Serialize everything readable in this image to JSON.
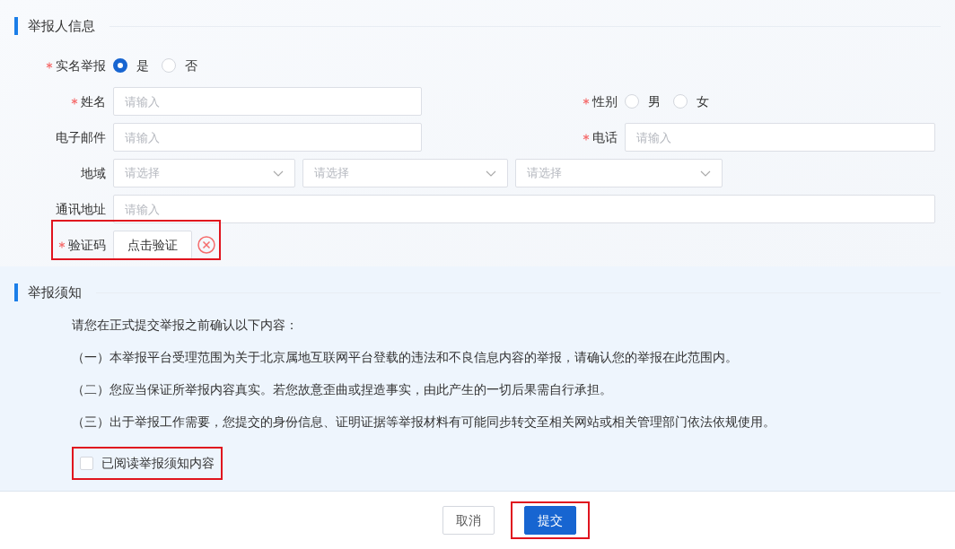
{
  "reporter_info": {
    "title": "举报人信息",
    "rows": [
      [
        {
          "kind": "radio",
          "label": "实名举报",
          "required": true,
          "options": [
            {
              "label": "是",
              "selected": true
            },
            {
              "label": "否",
              "selected": false
            }
          ]
        }
      ],
      [
        {
          "kind": "input",
          "label": "姓名",
          "required": true,
          "placeholder": "请输入"
        },
        {
          "kind": "radio",
          "label": "性别",
          "required": true,
          "options": [
            {
              "label": "男",
              "selected": false
            },
            {
              "label": "女",
              "selected": false
            }
          ]
        }
      ],
      [
        {
          "kind": "input",
          "label": "电子邮件",
          "required": false,
          "placeholder": "请输入"
        },
        {
          "kind": "input",
          "label": "电话",
          "required": true,
          "placeholder": "请输入"
        }
      ],
      [
        {
          "kind": "selects",
          "label": "地域",
          "required": false,
          "selects": [
            {
              "placeholder": "请选择"
            },
            {
              "placeholder": "请选择"
            },
            {
              "placeholder": "请选择"
            }
          ]
        }
      ],
      [
        {
          "kind": "input",
          "label": "通讯地址",
          "required": false,
          "placeholder": "请输入"
        }
      ],
      [
        {
          "kind": "captcha",
          "label": "验证码",
          "required": true,
          "button": "点击验证",
          "error": true,
          "highlighted": true
        }
      ]
    ]
  },
  "notice": {
    "title": "举报须知",
    "intro": "请您在正式提交举报之前确认以下内容：",
    "items": [
      "（一）本举报平台受理范围为关于北京属地互联网平台登载的违法和不良信息内容的举报，请确认您的举报在此范围内。",
      "（二）您应当保证所举报内容真实。若您故意歪曲或捏造事实，由此产生的一切后果需自行承担。",
      "（三）出于举报工作需要，您提交的身份信息、证明证据等举报材料有可能同步转交至相关网站或相关管理部门依法依规使用。"
    ],
    "agreement": {
      "label": "已阅读举报须知内容",
      "checked": false,
      "highlighted": true
    }
  },
  "footer": {
    "buttons": [
      {
        "label": "取消",
        "kind": "default",
        "highlighted": false
      },
      {
        "label": "提交",
        "kind": "primary",
        "highlighted": true
      }
    ]
  }
}
